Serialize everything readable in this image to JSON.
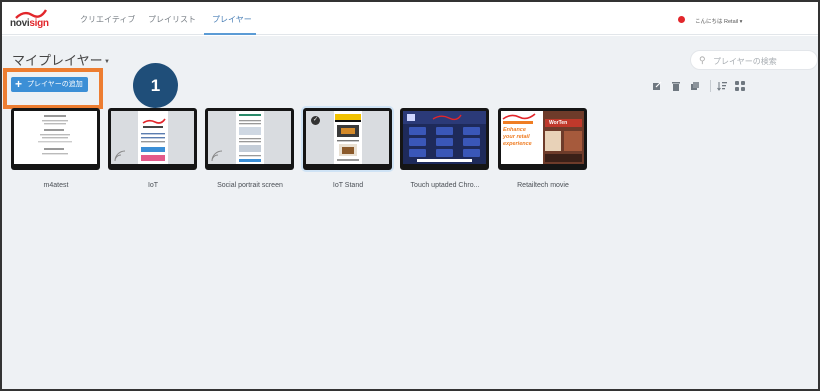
{
  "brand": {
    "logo_text_a": "novi",
    "logo_text_b": "sign",
    "accent": "#e2262b",
    "primary": "#3c8fd6",
    "highlight": "#ed7d31",
    "badge": "#1f4e79"
  },
  "nav": {
    "tabs": [
      "クリエイティブ",
      "プレイリスト",
      "プレイヤー"
    ],
    "active_tab": "プレイヤー"
  },
  "user": {
    "greeting": "こんにちは Retail"
  },
  "page": {
    "title": "マイプレイヤー",
    "add_button": "プレイヤーの追加"
  },
  "search": {
    "placeholder": "プレイヤーの検索"
  },
  "annotation": {
    "step": "1"
  },
  "toolbar": {
    "icons": [
      "edit-icon",
      "trash-icon",
      "copy-icon",
      "sort-icon",
      "grid-view-icon"
    ]
  },
  "players": [
    {
      "name": "m4atest"
    },
    {
      "name": "IoT"
    },
    {
      "name": "Social portrait screen"
    },
    {
      "name": "IoT Stand",
      "selected": true
    },
    {
      "name": "Touch uptaded Chro..."
    },
    {
      "name": "Retailtech movie"
    }
  ],
  "thumb_text": {
    "retail_line1": "Enhance",
    "retail_line2": "your retail",
    "retail_line3": "experience",
    "retail_brand": "WorTen"
  }
}
